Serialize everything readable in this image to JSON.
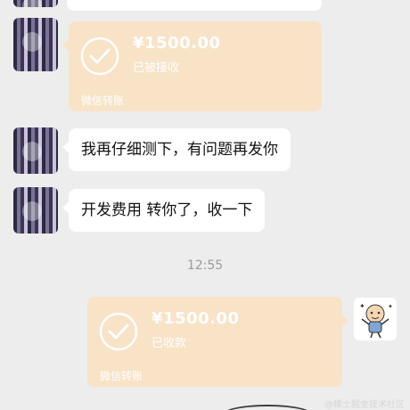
{
  "chat": {
    "messages": [
      {
        "kind": "transfer",
        "side": "left",
        "amount": "¥1500.00",
        "status": "已被接收",
        "footer": "微信转账"
      },
      {
        "kind": "text",
        "side": "left",
        "text": "我再仔细测下，有问题再发你"
      },
      {
        "kind": "text",
        "side": "left",
        "text": "开发费用 转你了，收一下"
      },
      {
        "kind": "time",
        "text": "12:55"
      },
      {
        "kind": "transfer",
        "side": "right",
        "amount": "¥1500.00",
        "status": "已收款",
        "footer": "微信转账"
      }
    ],
    "watermark": "@稀土掘金技术社区"
  },
  "colors": {
    "background": "#ededed",
    "bubble": "#ffffff",
    "transfer_card": "#f8e3c7",
    "timestamp": "#9b9b9b"
  },
  "icons": {
    "transfer_status": "check-circle-icon"
  }
}
